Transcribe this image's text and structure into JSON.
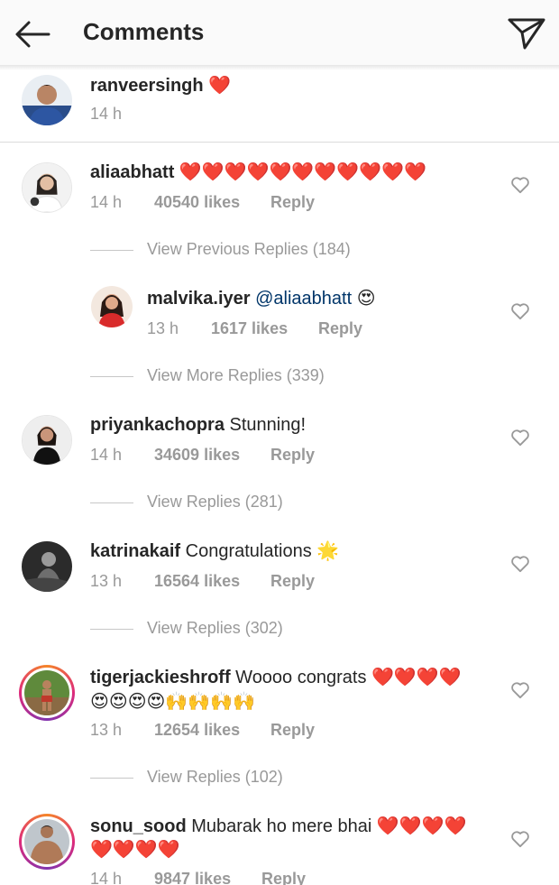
{
  "header": {
    "title": "Comments"
  },
  "caption": {
    "username": "ranveersingh",
    "emoji": "❤️",
    "time": "14 h"
  },
  "comments": [
    {
      "username": "aliaabhatt",
      "text": "❤️❤️❤️❤️❤️❤️❤️❤️❤️❤️❤️",
      "time": "14 h",
      "likes": "40540 likes",
      "reply": "Reply",
      "replies_link": "View Previous Replies (184)"
    },
    {
      "username": "malvika.iyer",
      "mention": "@aliaabhatt",
      "text": "😍",
      "time": "13 h",
      "likes": "1617 likes",
      "reply": "Reply",
      "replies_link": "View More Replies (339)"
    },
    {
      "username": "priyankachopra",
      "text": "Stunning!",
      "time": "14 h",
      "likes": "34609 likes",
      "reply": "Reply",
      "replies_link": "View Replies (281)"
    },
    {
      "username": "katrinakaif",
      "text": "Congratulations 🌟",
      "time": "13 h",
      "likes": "16564 likes",
      "reply": "Reply",
      "replies_link": "View Replies (302)"
    },
    {
      "username": "tigerjackieshroff",
      "text": "Woooo congrats ❤️❤️❤️❤️",
      "text_line2": "😍😍😍😍🙌🙌🙌🙌",
      "time": "13 h",
      "likes": "12654 likes",
      "reply": "Reply",
      "replies_link": "View Replies (102)"
    },
    {
      "username": "sonu_sood",
      "text": "Mubarak ho mere bhai ❤️❤️❤️❤️",
      "text_line2": "❤️❤️❤️❤️",
      "time": "14 h",
      "likes": "9847 likes",
      "reply": "Reply"
    }
  ],
  "icons": {
    "back": "arrow-left-icon",
    "send": "paper-plane-icon",
    "like": "heart-outline-icon"
  },
  "colors": {
    "text": "#262626",
    "secondary": "#999999",
    "mention": "#003569",
    "heart_red": "#e0202a"
  }
}
